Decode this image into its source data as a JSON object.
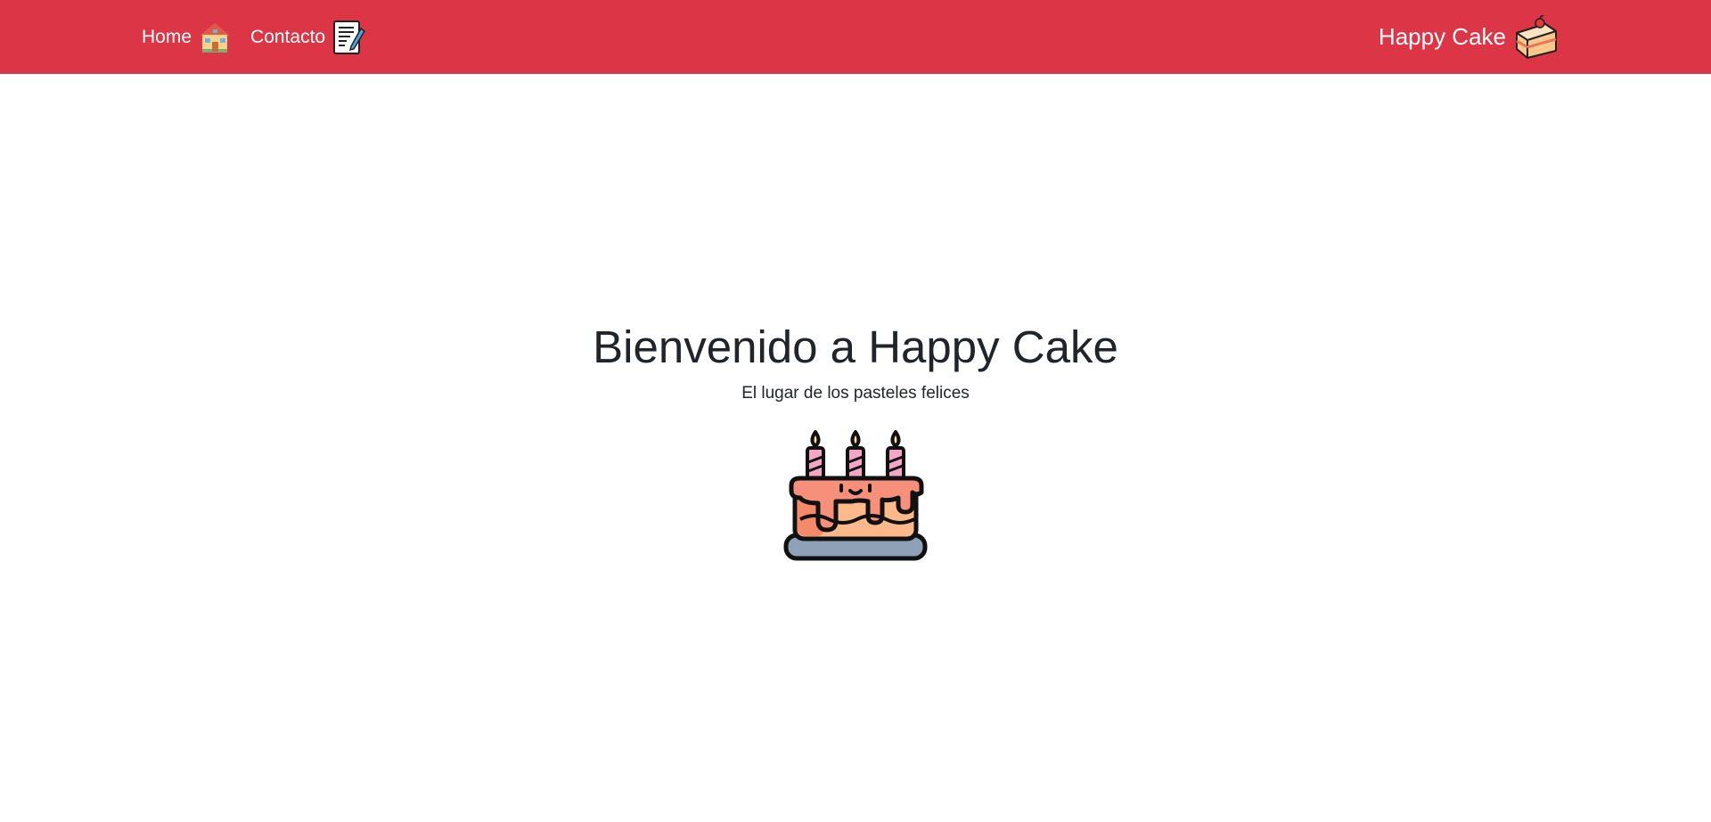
{
  "navbar": {
    "background": "#dc3545",
    "links": [
      {
        "label": "Home",
        "icon": "house-icon"
      },
      {
        "label": "Contacto",
        "icon": "memo-icon"
      }
    ],
    "brand": {
      "label": "Happy Cake",
      "icon": "cake-slice-icon"
    }
  },
  "hero": {
    "title": "Bienvenido a Happy Cake",
    "subtitle": "El lugar de los pasteles felices",
    "image_icon": "birthday-cake-icon"
  }
}
